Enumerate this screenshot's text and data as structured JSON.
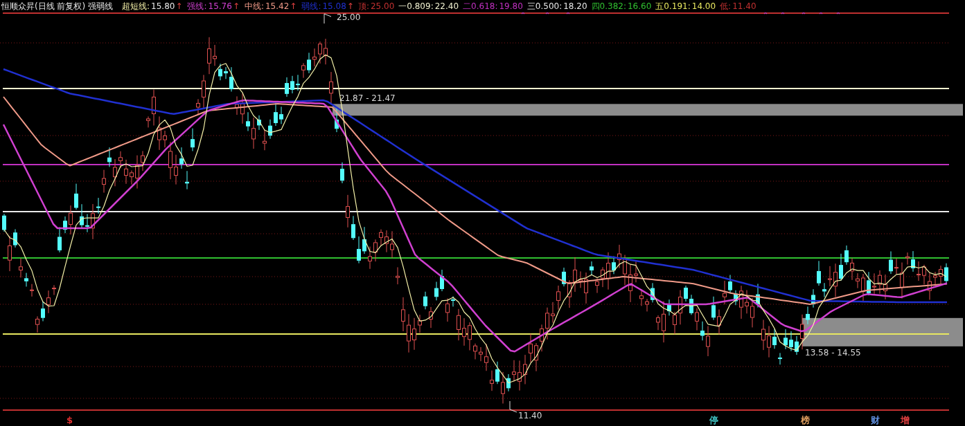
{
  "title": "恒顺众昇(日线 前复权) 强弱线",
  "indicators": [
    {
      "label": "超短线:",
      "value": "15.80",
      "arrow": "↑",
      "color": "#f4f0a8"
    },
    {
      "label": "强线:",
      "value": "15.76",
      "arrow": "↑",
      "color": "#d040d0"
    },
    {
      "label": "中线:",
      "value": "15.42",
      "arrow": "↑",
      "color": "#f09a88"
    },
    {
      "label": "弱线:",
      "value": "15.08",
      "arrow": "↑",
      "color": "#2030d0"
    }
  ],
  "levels": [
    {
      "label": "顶:",
      "value": "25.00",
      "color": "#c03030"
    },
    {
      "label": "一0.809:",
      "value": "22.40",
      "color": "#f0f0d0"
    },
    {
      "label": "二0.618:",
      "value": "19.80",
      "color": "#c030c0"
    },
    {
      "label": "三0.500:",
      "value": "18.20",
      "color": "#e8e8e8"
    },
    {
      "label": "四0.382:",
      "value": "16.60",
      "color": "#30c030"
    },
    {
      "label": "五0.191:",
      "value": "14.00",
      "color": "#e8e860"
    },
    {
      "label": "低:",
      "value": "11.40",
      "color": "#c03030"
    }
  ],
  "zones": [
    {
      "label": "21.87 - 21.47"
    },
    {
      "label": "13.58 - 14.55"
    }
  ],
  "price_marks": [
    {
      "text": "25.00"
    },
    {
      "text": "11.40"
    }
  ],
  "signals": [
    {
      "text": "$",
      "color": "#e03030"
    },
    {
      "text": "停",
      "color": "#40c0c0"
    },
    {
      "text": "榜",
      "color": "#e0a060"
    },
    {
      "text": "财",
      "color": "#6090e0"
    },
    {
      "text": "增",
      "color": "#e04040"
    }
  ]
}
